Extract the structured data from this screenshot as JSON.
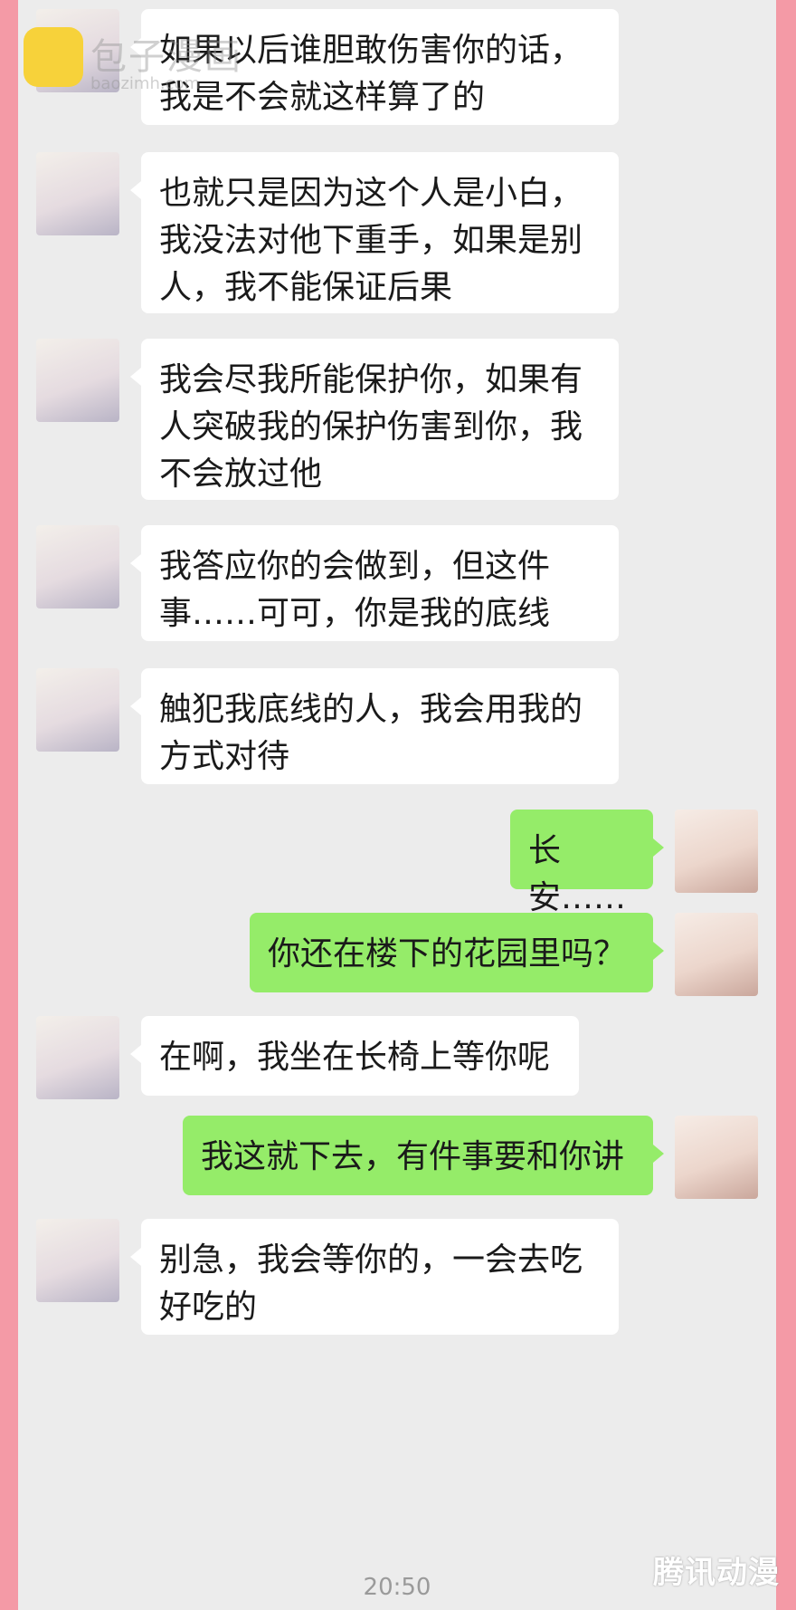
{
  "watermark": {
    "logo_text": "包子漫画",
    "logo_sub": "baozimh.com",
    "brand": "腾讯动漫"
  },
  "colors": {
    "page_border": "#f49aa6",
    "chat_bg": "#ececec",
    "incoming_bubble": "#ffffff",
    "outgoing_bubble": "#95ec69"
  },
  "messages": [
    {
      "side": "left",
      "avatar": "boy-avatar",
      "lines": [
        "如果以后谁胆敢伤害你的话，",
        "我是不会就这样算了的"
      ]
    },
    {
      "side": "left",
      "avatar": "boy-avatar",
      "lines": [
        "也就只是因为这个人是小白，",
        "我没法对他下重手，如果是别",
        "人，我不能保证后果"
      ]
    },
    {
      "side": "left",
      "avatar": "boy-avatar",
      "lines": [
        "我会尽我所能保护你，如果有",
        "人突破我的保护伤害到你，我",
        "不会放过他"
      ]
    },
    {
      "side": "left",
      "avatar": "boy-avatar",
      "lines": [
        "我答应你的会做到，但这件",
        "事……可可，你是我的底线"
      ]
    },
    {
      "side": "left",
      "avatar": "boy-avatar",
      "lines": [
        "触犯我底线的人，我会用我的",
        "方式对待"
      ]
    },
    {
      "side": "right",
      "avatar": "girl-avatar",
      "lines": [
        "长安……"
      ]
    },
    {
      "side": "right",
      "avatar": "girl-avatar",
      "lines": [
        "你还在楼下的花园里吗？"
      ]
    },
    {
      "side": "left",
      "avatar": "boy-avatar",
      "lines": [
        "在啊，我坐在长椅上等你呢"
      ]
    },
    {
      "side": "right",
      "avatar": "girl-avatar",
      "lines": [
        "我这就下去，有件事要和你讲"
      ]
    },
    {
      "side": "left",
      "avatar": "boy-avatar",
      "lines": [
        "别急，我会等你的，一会去吃",
        "好吃的"
      ]
    }
  ],
  "timestamp": "20:50"
}
